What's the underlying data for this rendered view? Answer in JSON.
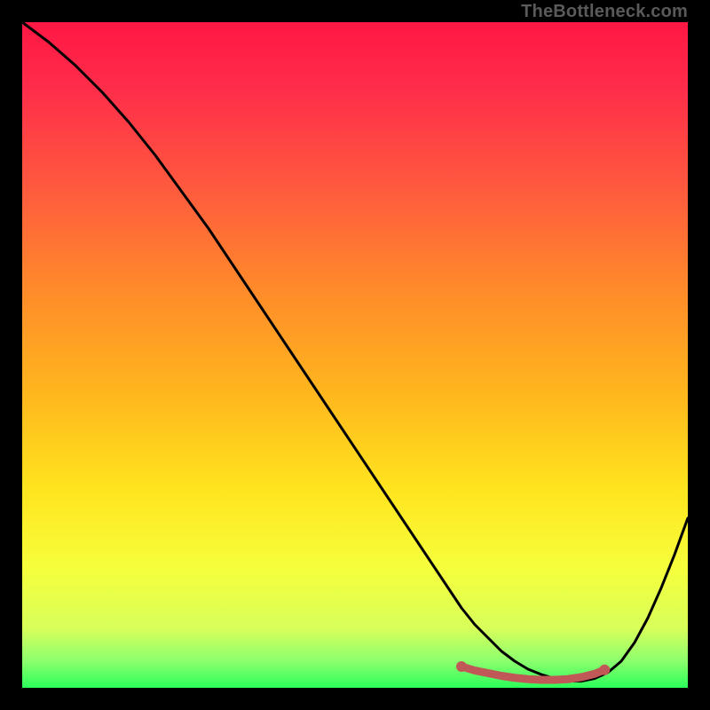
{
  "watermark": "TheBottleneck.com",
  "colors": {
    "frame": "#000000",
    "gradient_stops": [
      {
        "offset": 0.0,
        "color": "#ff1744"
      },
      {
        "offset": 0.1,
        "color": "#ff2d4a"
      },
      {
        "offset": 0.25,
        "color": "#ff5a3e"
      },
      {
        "offset": 0.4,
        "color": "#ff8a2a"
      },
      {
        "offset": 0.55,
        "color": "#ffb41e"
      },
      {
        "offset": 0.7,
        "color": "#ffe41e"
      },
      {
        "offset": 0.82,
        "color": "#f6ff3c"
      },
      {
        "offset": 0.91,
        "color": "#d8ff5a"
      },
      {
        "offset": 0.96,
        "color": "#8cff6e"
      },
      {
        "offset": 1.0,
        "color": "#2bff5a"
      }
    ],
    "curve": "#000000",
    "markers": "#c15858"
  },
  "chart_data": {
    "type": "line",
    "title": "",
    "xlabel": "",
    "ylabel": "",
    "xlim": [
      0,
      100
    ],
    "ylim": [
      0,
      100
    ],
    "grid": false,
    "legend": false,
    "series": [
      {
        "name": "bottleneck-curve",
        "x": [
          0,
          4,
          8,
          12,
          16,
          20,
          24,
          28,
          32,
          36,
          40,
          44,
          48,
          52,
          56,
          60,
          64,
          66,
          68,
          70,
          72,
          74,
          76,
          78,
          80,
          82,
          84,
          86,
          88,
          90,
          92,
          94,
          96,
          98,
          100
        ],
        "y": [
          100,
          97,
          93.5,
          89.5,
          85,
          80,
          74.5,
          69,
          63,
          57,
          51,
          45,
          39,
          33,
          27,
          21,
          15,
          12,
          9.5,
          7.5,
          5.5,
          4,
          2.8,
          2,
          1.4,
          1,
          1,
          1.4,
          2.3,
          4,
          6.8,
          10.5,
          15,
          20,
          25.5
        ]
      }
    ],
    "markers": {
      "name": "optimal-range",
      "x": [
        66,
        68,
        70,
        72,
        74,
        76,
        78,
        80,
        82,
        84,
        86,
        87.5
      ],
      "y": [
        3.2,
        2.6,
        2.2,
        1.8,
        1.5,
        1.3,
        1.2,
        1.2,
        1.3,
        1.6,
        2.1,
        2.7
      ]
    }
  }
}
